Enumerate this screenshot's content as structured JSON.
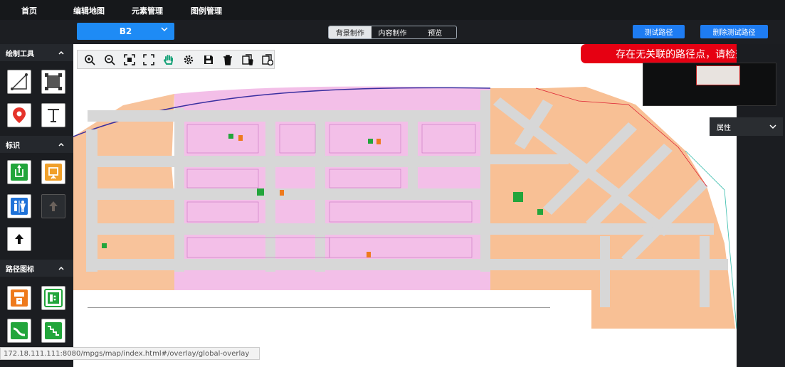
{
  "nav": {
    "items": [
      "首页",
      "编辑地图",
      "元素管理",
      "图例管理"
    ]
  },
  "toolbar": {
    "floor": "B2",
    "tabs": [
      "背景制作",
      "内容制作",
      "预览"
    ],
    "active_tab": "背景制作",
    "test_route": "测试路径",
    "delete_test_route": "删除测试路径"
  },
  "sidebar": {
    "sections": [
      {
        "title": "绘制工具",
        "icons": [
          "line-tool-icon",
          "rect-tool-icon",
          "location-pin-icon",
          "text-tool-icon"
        ]
      },
      {
        "title": "标识",
        "icons": [
          "exit-sign-green-icon",
          "exit-sign-orange-icon",
          "restroom-icon",
          "up-arrow-gray-icon",
          "up-arrow-icon"
        ]
      },
      {
        "title": "路径图标",
        "icons": [
          "elevator-icon",
          "escalator-icon",
          "stairs-green-icon",
          "stairs-icon"
        ]
      }
    ]
  },
  "map_tools": {
    "icons": [
      "zoom-in-icon",
      "zoom-out-icon",
      "fit-icon",
      "fullscreen-icon",
      "pan-hand-icon",
      "settings-icon",
      "save-icon",
      "delete-icon",
      "copy-delete-icon",
      "layer-icon"
    ]
  },
  "alert": {
    "text": "存在无关联的路径点，请检查!"
  },
  "properties": {
    "label": "属性"
  },
  "status": {
    "url": "172.18.111.111:8080/mpgs/map/index.html#/overlay/global-overlay"
  },
  "colors": {
    "accent": "#1e8bf5",
    "alert": "#e60012",
    "zone_pink": "#f2b8e6",
    "zone_orange": "#f7b98a",
    "corridor": "#d7d7d7"
  }
}
